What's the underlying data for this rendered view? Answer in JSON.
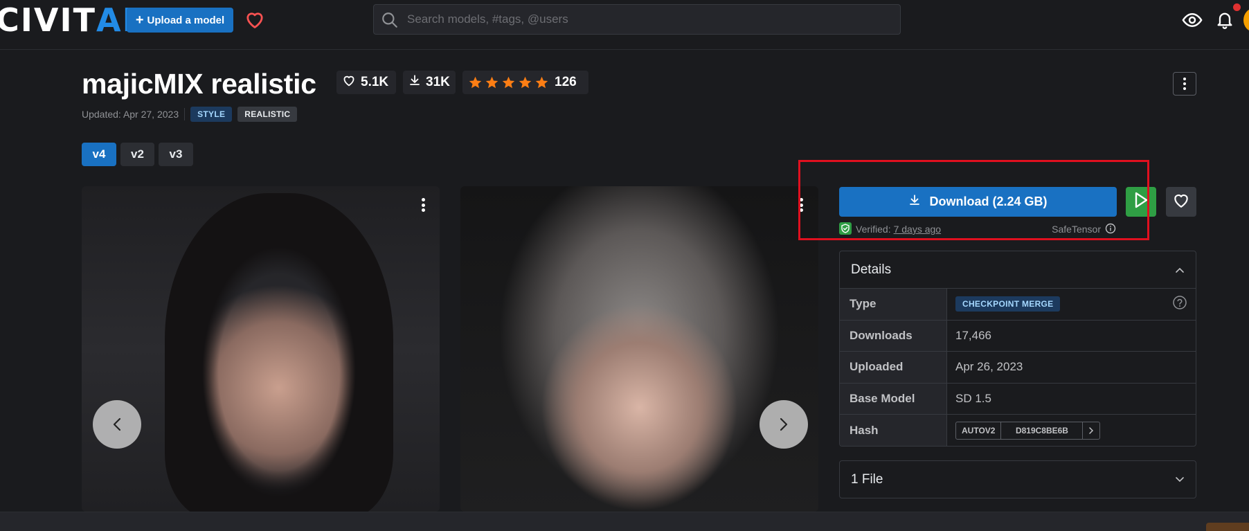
{
  "header": {
    "logo_civit": "CIVIT",
    "logo_ai": "AI",
    "upload_label": "Upload a model",
    "search_placeholder": "Search models, #tags, @users"
  },
  "model": {
    "title": "majicMIX realistic",
    "likes": "5.1K",
    "downloads": "31K",
    "rating_stars": 5,
    "rating_count": "126",
    "updated": "Updated: Apr 27, 2023",
    "tags": [
      "STYLE",
      "REALISTIC"
    ]
  },
  "versions": [
    {
      "label": "v4",
      "active": true
    },
    {
      "label": "v2",
      "active": false
    },
    {
      "label": "v3",
      "active": false
    }
  ],
  "download": {
    "label": "Download (2.24 GB)",
    "verified_prefix": "Verified:",
    "verified_date": "7 days ago",
    "format": "SafeTensor"
  },
  "details": {
    "heading": "Details",
    "rows": [
      {
        "key": "Type",
        "value": "CHECKPOINT MERGE"
      },
      {
        "key": "Downloads",
        "value": "17,466"
      },
      {
        "key": "Uploaded",
        "value": "Apr 26, 2023"
      },
      {
        "key": "Base Model",
        "value": "SD 1.5"
      },
      {
        "key": "Hash",
        "hash_type": "AUTOV2",
        "hash_value": "D819C8BE6B"
      }
    ]
  },
  "files": {
    "label": "1 File"
  },
  "colors": {
    "accent": "#1971c2",
    "run": "#2f9e44",
    "highlight": "#e0101f",
    "star": "#fd7e14",
    "heart": "#fa5252"
  }
}
